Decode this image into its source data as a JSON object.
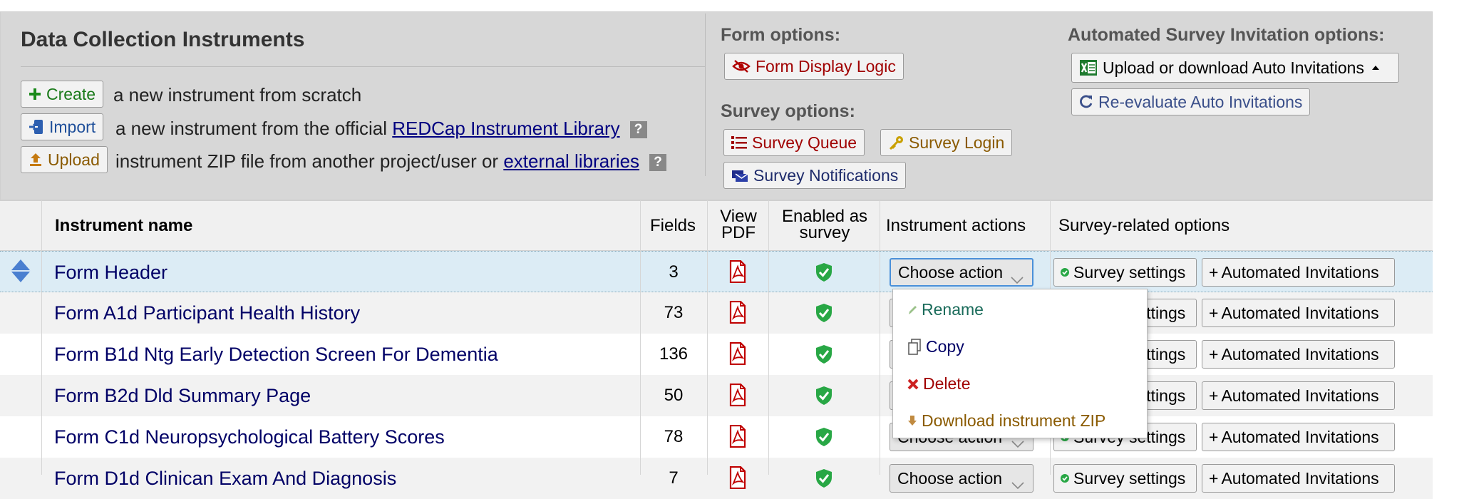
{
  "header": {
    "title": "Data Collection Instruments",
    "create": {
      "label": "Create",
      "suffix": "a new instrument from scratch"
    },
    "import": {
      "label": "Import",
      "prefix": "a new instrument from the official",
      "link": "REDCap Instrument Library"
    },
    "upload": {
      "label": "Upload",
      "prefix": "instrument ZIP file from another project/user or",
      "link": "external libraries"
    },
    "help_glyph": "?"
  },
  "form_options": {
    "heading": "Form options:",
    "display_logic": "Form Display Logic"
  },
  "survey_options": {
    "heading": "Survey options:",
    "queue": "Survey Queue",
    "login": "Survey Login",
    "notifications": "Survey Notifications"
  },
  "auto_options": {
    "heading": "Automated Survey Invitation options:",
    "upload_download": "Upload or download Auto Invitations",
    "reevaluate": "Re-evaluate Auto Invitations"
  },
  "table": {
    "headers": {
      "name": "Instrument name",
      "fields": "Fields",
      "view_pdf_1": "View",
      "view_pdf_2": "PDF",
      "enabled_1": "Enabled as",
      "enabled_2": "survey",
      "actions": "Instrument actions",
      "survey_options": "Survey-related options"
    },
    "rows": [
      {
        "name": "Form Header",
        "fields": "3"
      },
      {
        "name": "Form A1d Participant Health History",
        "fields": "73"
      },
      {
        "name": "Form B1d Ntg Early Detection Screen For Dementia",
        "fields": "136"
      },
      {
        "name": "Form B2d Dld Summary Page",
        "fields": "50"
      },
      {
        "name": "Form C1d Neuropsychological Battery Scores",
        "fields": "78"
      },
      {
        "name": "Form D1d Clinican Exam And Diagnosis",
        "fields": "7"
      }
    ],
    "choose_action": "Choose action",
    "survey_settings": "Survey settings",
    "auto_invitations": "Automated Invitations",
    "plus": "+"
  },
  "dropdown": {
    "rename": "Rename",
    "copy": "Copy",
    "delete": "Delete",
    "download_zip": "Download instrument ZIP"
  },
  "colors": {
    "panel_bg": "#d7d7d7",
    "selected_row": "#dcecf5",
    "alt_row": "#f2f2f2",
    "link_navy": "#000066",
    "red": "#a00000",
    "green": "#1a7a1a",
    "orange": "#8a5a00",
    "blue": "#3a4f8a"
  }
}
